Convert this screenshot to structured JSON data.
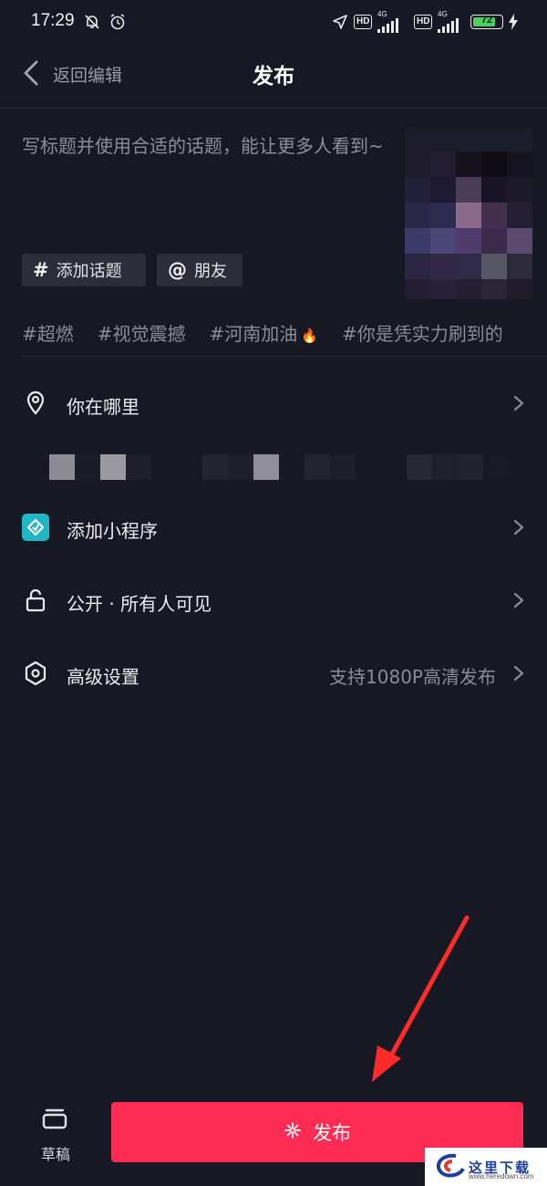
{
  "status_bar": {
    "time": "17:29",
    "hd1": "HD",
    "net1": "4G",
    "hd2": "HD",
    "net2": "4G",
    "battery_level": "72",
    "icons": [
      "mute-bell-icon",
      "alarm-icon",
      "location-icon",
      "signal-icon",
      "charging-icon"
    ]
  },
  "header": {
    "back_label": "返回编辑",
    "title": "发布"
  },
  "caption": {
    "placeholder": "写标题并使用合适的话题，能让更多人看到~"
  },
  "chips": [
    {
      "icon": "#",
      "label": "添加话题"
    },
    {
      "icon": "@",
      "label": "朋友"
    }
  ],
  "hashtags": [
    "#超燃",
    "#视觉震撼",
    "#河南加油",
    "#你是凭实力刷到的"
  ],
  "rows": {
    "location": {
      "label": "你在哪里"
    },
    "mini_program": {
      "label": "添加小程序"
    },
    "privacy": {
      "label": "公开 · 所有人可见"
    },
    "advanced": {
      "label": "高级设置",
      "value": "支持1080P高清发布"
    }
  },
  "bottom": {
    "draft_label": "草稿",
    "publish_label": "发布"
  },
  "watermark": {
    "text": "这里下载",
    "url": "www.heredown.com"
  },
  "colors": {
    "background": "#161823",
    "accent": "#fe2c55",
    "mini_program_badge": "#1fb5c2",
    "battery": "#48d15c"
  }
}
